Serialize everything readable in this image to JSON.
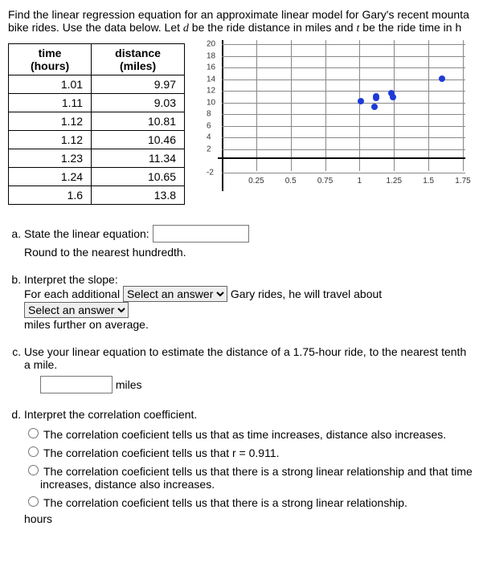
{
  "intro": {
    "line1": "Find the linear regression equation for an approximate linear model for Gary's recent mounta",
    "line2_a": "bike rides. Use the data below. Let ",
    "var_d": "d",
    "line2_b": " be the ride distance in miles and ",
    "var_t": "t",
    "line2_c": " be the ride time in h"
  },
  "table": {
    "head_time1": "time",
    "head_time2": "(hours)",
    "head_dist1": "distance",
    "head_dist2": "(miles)",
    "rows": [
      {
        "t": "1.01",
        "d": "9.97"
      },
      {
        "t": "1.11",
        "d": "9.03"
      },
      {
        "t": "1.12",
        "d": "10.81"
      },
      {
        "t": "1.12",
        "d": "10.46"
      },
      {
        "t": "1.23",
        "d": "11.34"
      },
      {
        "t": "1.24",
        "d": "10.65"
      },
      {
        "t": "1.6",
        "d": "13.8"
      }
    ]
  },
  "chart_data": {
    "type": "scatter",
    "x": [
      1.01,
      1.11,
      1.12,
      1.12,
      1.23,
      1.24,
      1.6
    ],
    "y": [
      9.97,
      9.03,
      10.81,
      10.46,
      11.34,
      10.65,
      13.8
    ],
    "xlim": [
      0,
      1.75
    ],
    "ylim": [
      -2,
      20
    ],
    "xticks": [
      0.25,
      0.5,
      0.75,
      1,
      1.25,
      1.5,
      1.75
    ],
    "yticks": [
      -2,
      2,
      4,
      6,
      8,
      10,
      12,
      14,
      16,
      18,
      20
    ],
    "grid": true
  },
  "qa": {
    "a_prompt": "State the linear equation:",
    "a_sub": "Round to the nearest hundredth.",
    "b_1": "Interpret the slope:",
    "b_2a": "For each additional ",
    "b_sel": "Select an answer",
    "b_2b": " Gary rides, he will travel about ",
    "b_3": "miles further on average.",
    "c_1": "Use your linear equation to estimate the distance of a 1.75-hour ride, to the nearest tenth",
    "c_2": "a mile.",
    "c_unit": "miles",
    "d_prompt": "Interpret the correlation coefficient.",
    "d_opts": [
      "The correlation coeficient tells us that as time increases, distance also increases.",
      "The correlation coeficient tells us that r = 0.911.",
      "The correlation coeficient tells us that there is a strong linear relationship and that time increases, distance also increases.",
      "The correlation coeficient tells us that there is a strong linear relationship."
    ],
    "d_unit": "hours"
  }
}
